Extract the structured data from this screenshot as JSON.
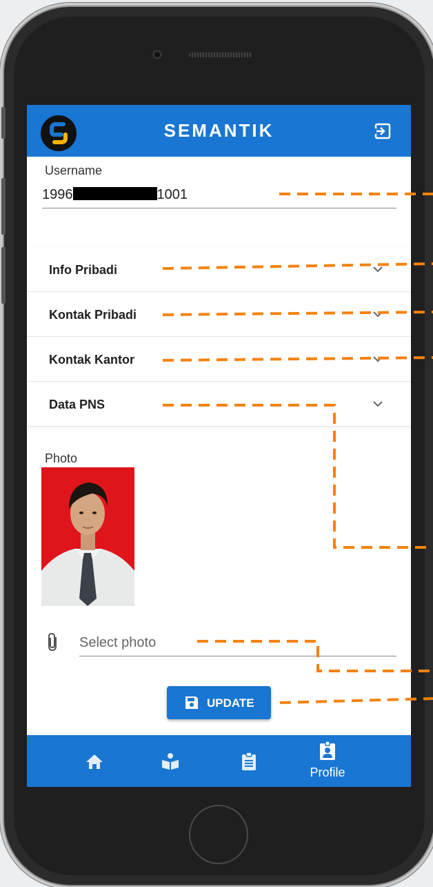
{
  "app": {
    "title": "SEMANTIK",
    "brand_color": "#1976d2",
    "logo_letter": "S"
  },
  "username": {
    "label": "Username",
    "value_prefix": "1996",
    "value_suffix": "1001"
  },
  "panels": [
    {
      "label": "Info Pribadi",
      "icon": "chevron-down-icon"
    },
    {
      "label": "Kontak Pribadi",
      "icon": "chevron-down-icon"
    },
    {
      "label": "Kontak Kantor",
      "icon": "chevron-down-icon"
    },
    {
      "label": "Data PNS",
      "icon": "chevron-down-icon"
    }
  ],
  "photo": {
    "label": "Photo",
    "select_placeholder": "Select photo"
  },
  "update_button": {
    "label": "UPDATE",
    "icon": "save-icon"
  },
  "bottom_nav": {
    "items": [
      {
        "icon": "home-icon",
        "label": ""
      },
      {
        "icon": "book-reader-icon",
        "label": ""
      },
      {
        "icon": "clipboard-icon",
        "label": ""
      },
      {
        "icon": "id-badge-icon",
        "label": "Profile",
        "active": true
      }
    ]
  },
  "annotation_color": "#f5820d"
}
